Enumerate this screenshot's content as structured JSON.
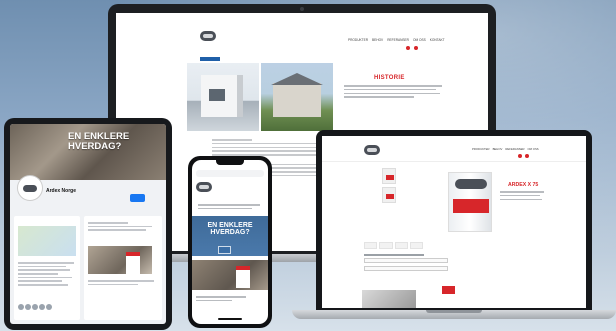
{
  "laptop": {
    "nav_items": [
      "PRODUKTER",
      "BEHOV",
      "REFERANSER",
      "OM OSS",
      "KONTAKT"
    ],
    "section_title": "HISTORIE"
  },
  "macbook": {
    "nav_items": [
      "PRODUKTER",
      "BEHOV",
      "REFERANSER",
      "OM OSS"
    ],
    "product_title": "ARDEX X 75"
  },
  "tablet": {
    "cover_title": "EN ENKLERE HVERDAG?",
    "page_name": "Ardex Norge"
  },
  "phone": {
    "ad_title": "EN ENKLERE HVERDAG?"
  },
  "colors": {
    "brand_red": "#d7262a",
    "facebook_blue": "#1877f2",
    "device_frame": "#17191c"
  }
}
